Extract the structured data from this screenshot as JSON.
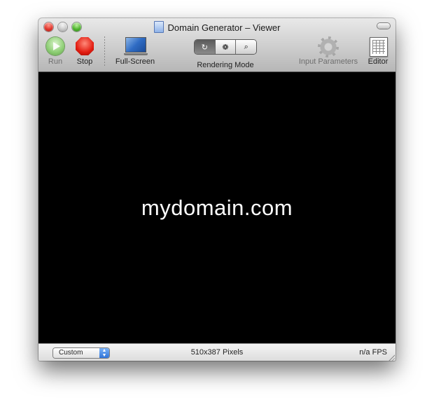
{
  "window": {
    "title": "Domain Generator – Viewer"
  },
  "toolbar": {
    "run_label": "Run",
    "stop_label": "Stop",
    "fullscreen_label": "Full-Screen",
    "rendering_mode_label": "Rendering Mode",
    "rendering_modes": [
      "↻",
      "❁",
      "⌕"
    ],
    "input_parameters_label": "Input Parameters",
    "editor_label": "Editor"
  },
  "canvas": {
    "text": "mydomain.com"
  },
  "status": {
    "size_preset": "Custom",
    "pixels": "510x387 Pixels",
    "fps": "n/a FPS"
  }
}
